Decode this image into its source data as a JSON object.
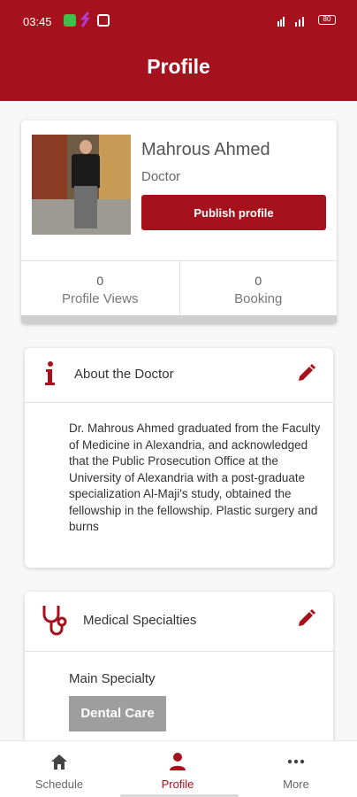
{
  "status_bar": {
    "time": "03:45",
    "battery": "80"
  },
  "header": {
    "title": "Profile"
  },
  "profile": {
    "name": "Mahrous Ahmed",
    "role": "Doctor",
    "publish_label": "Publish profile",
    "stats": [
      {
        "value": "0",
        "label": "Profile Views"
      },
      {
        "value": "0",
        "label": "Booking"
      }
    ]
  },
  "about": {
    "title": "About the Doctor",
    "text": "Dr. Mahrous Ahmed graduated from the Faculty of Medicine in Alexandria, and acknowledged that the Public Prosecution Office at the University of Alexandria with a post-graduate specialization Al-Maji's study, obtained the fellowship in the fellowship. Plastic surgery and burns"
  },
  "specialties": {
    "title": "Medical Specialties",
    "main_label": "Main Specialty",
    "main_value": "Dental Care"
  },
  "bottom_nav": [
    {
      "label": "Schedule",
      "icon": "home-icon"
    },
    {
      "label": "Profile",
      "icon": "person-icon"
    },
    {
      "label": "More",
      "icon": "more-icon"
    }
  ],
  "colors": {
    "primary": "#a5111c",
    "chip": "#9e9e9e"
  }
}
